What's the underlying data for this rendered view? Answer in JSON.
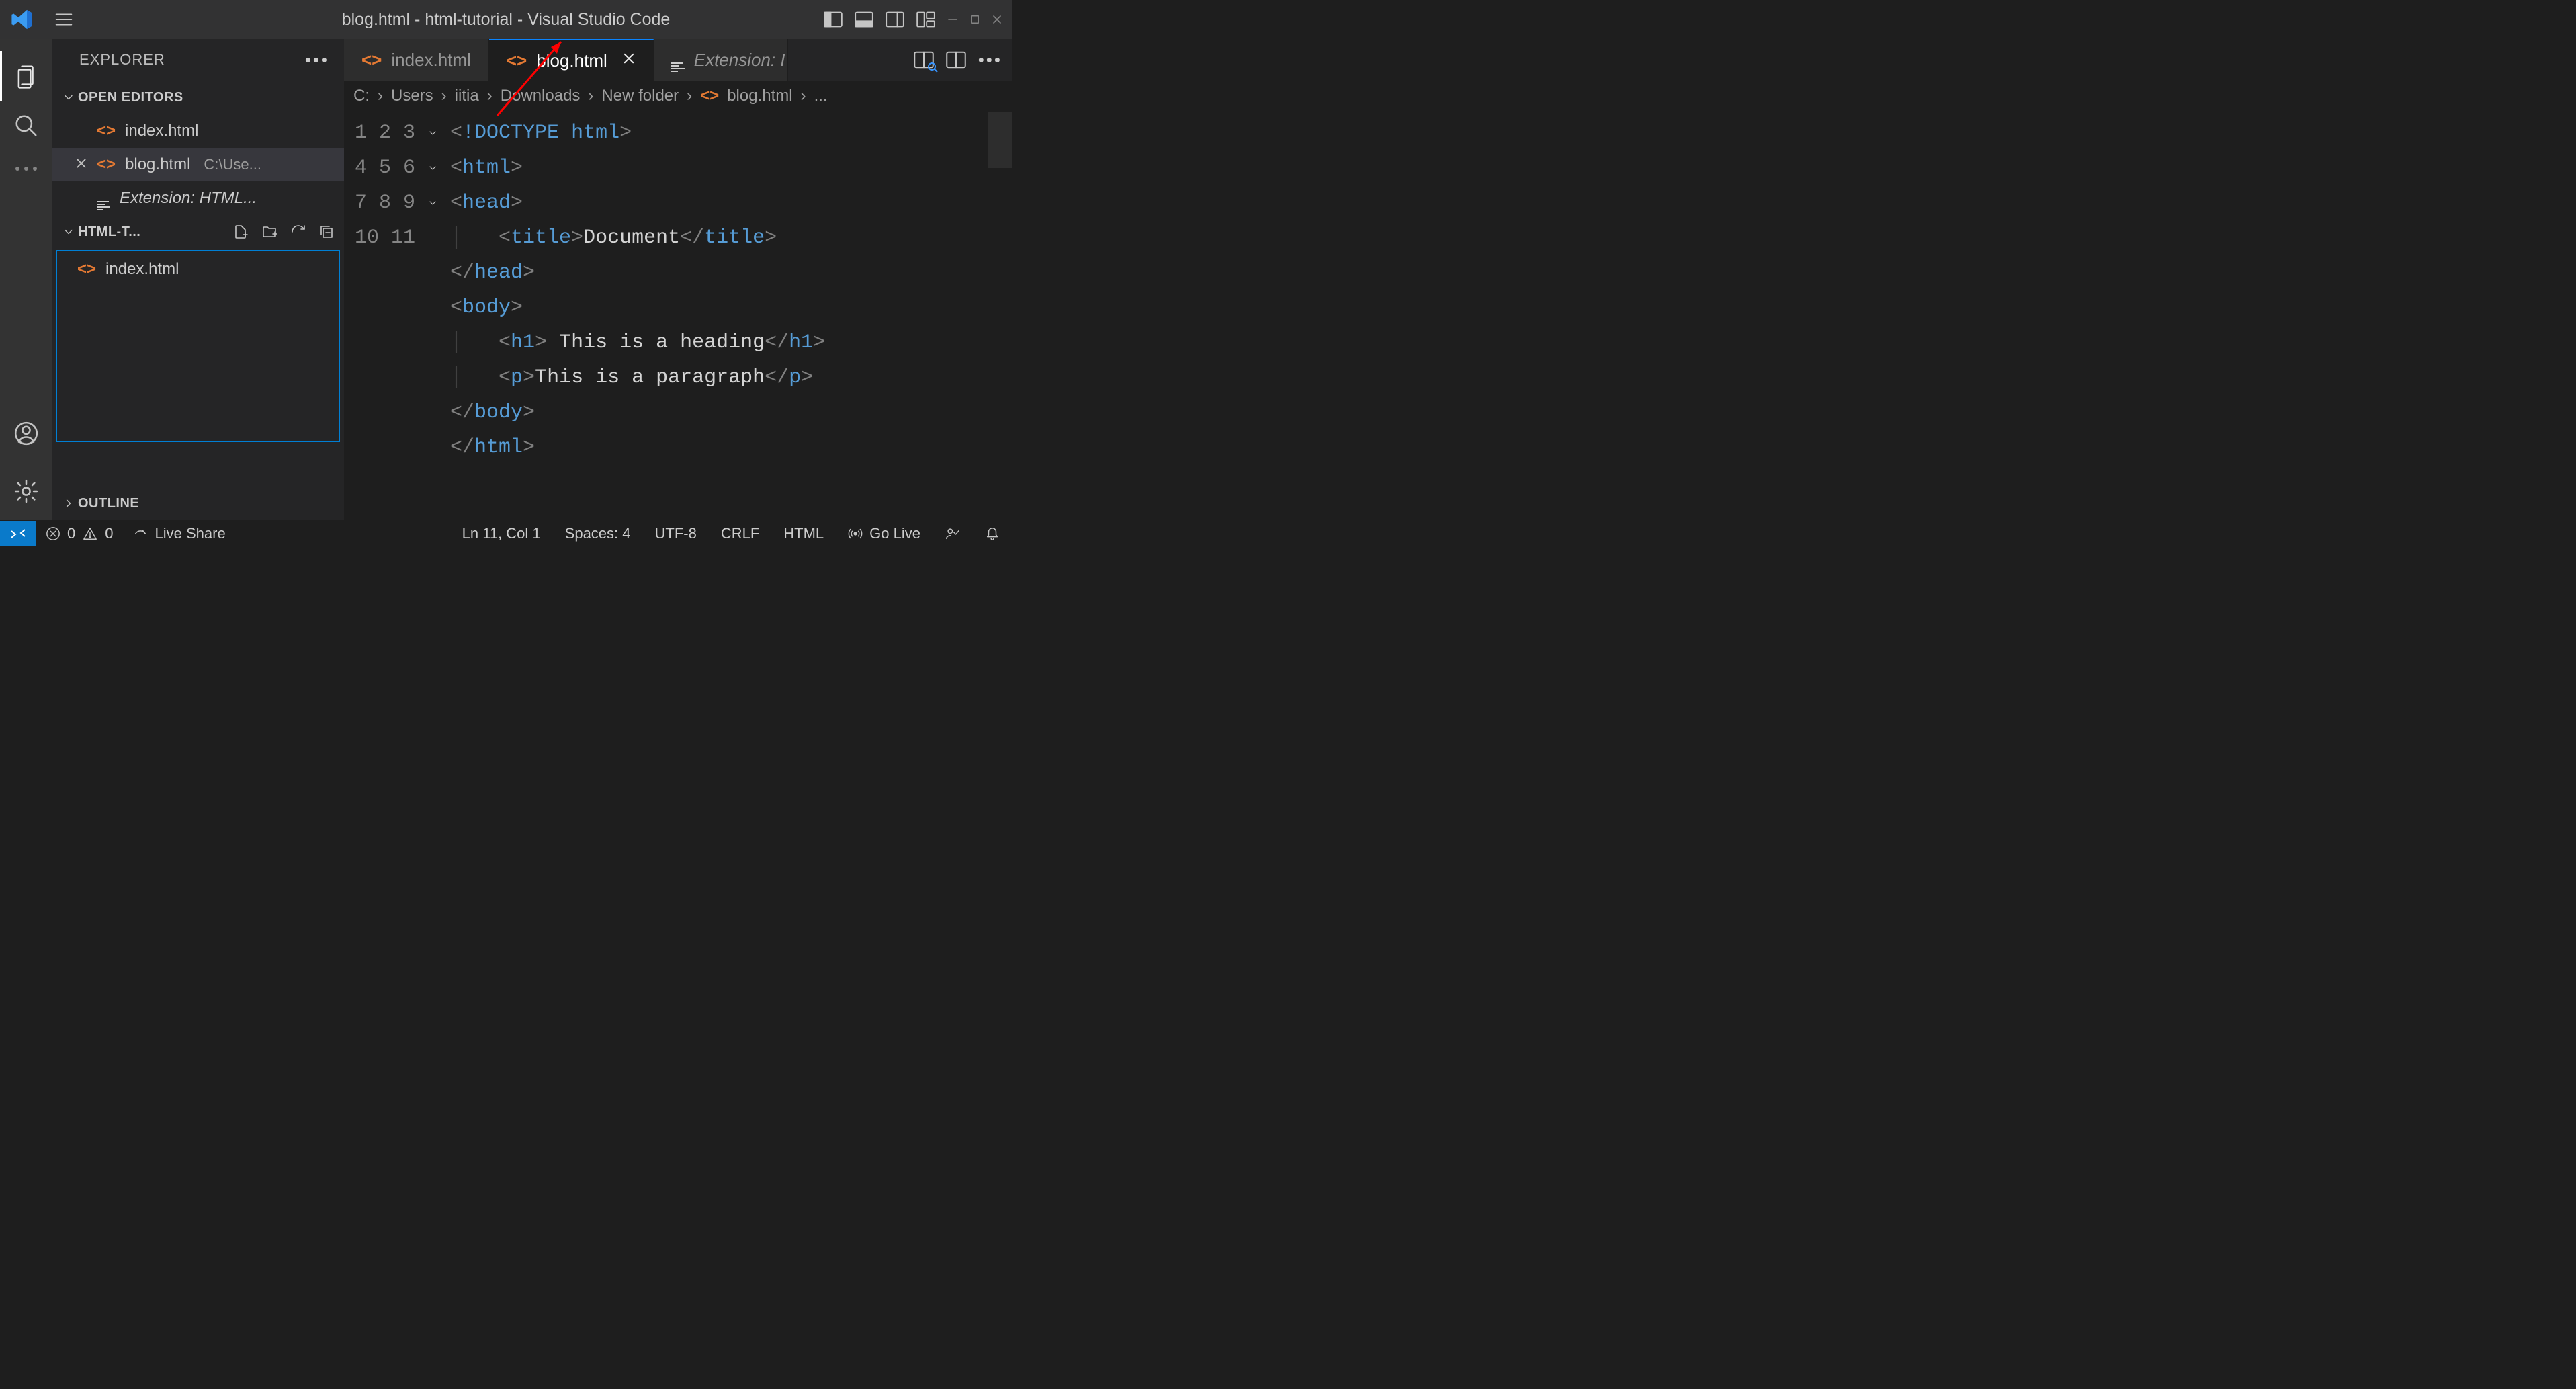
{
  "titlebar": {
    "title": "blog.html - html-tutorial - Visual Studio Code"
  },
  "activitybar": {
    "items": [
      "explorer",
      "search",
      "ellipsis"
    ],
    "bottom": [
      "accounts",
      "manage"
    ]
  },
  "sidebar": {
    "title": "EXPLORER",
    "open_editors": {
      "label": "OPEN EDITORS",
      "items": [
        {
          "name": "index.html",
          "kind": "html",
          "active": false,
          "meta": ""
        },
        {
          "name": "blog.html",
          "kind": "html",
          "active": true,
          "meta": "C:\\Use..."
        },
        {
          "name": "Extension: HTML...",
          "kind": "ext",
          "active": false,
          "meta": ""
        }
      ]
    },
    "folder": {
      "label": "HTML-T...",
      "files": [
        {
          "name": "index.html",
          "kind": "html"
        }
      ]
    },
    "outline_label": "OUTLINE"
  },
  "tabs": {
    "items": [
      {
        "name": "index.html",
        "kind": "html",
        "active": false,
        "closeable": false
      },
      {
        "name": "blog.html",
        "kind": "html",
        "active": true,
        "closeable": true
      },
      {
        "name": "Extension: I",
        "kind": "ext",
        "active": false,
        "closeable": false
      }
    ]
  },
  "breadcrumb": {
    "parts": [
      "C:",
      "Users",
      "iitia",
      "Downloads",
      "New folder"
    ],
    "file": "blog.html",
    "trailing": "..."
  },
  "code": {
    "lines": [
      {
        "n": 1,
        "fold": "",
        "html": "<span class='tok-br'>&lt;</span><span class='tok-bang'>!</span><span class='tok-doc'>DOCTYPE</span> <span class='tok-tag'>html</span><span class='tok-br'>&gt;</span>"
      },
      {
        "n": 2,
        "fold": "v",
        "html": "<span class='tok-br'>&lt;</span><span class='tok-tag'>html</span><span class='tok-br'>&gt;</span>"
      },
      {
        "n": 3,
        "fold": "v",
        "html": "<span class='tok-br'>&lt;</span><span class='tok-tag'>head</span><span class='tok-br'>&gt;</span>"
      },
      {
        "n": 4,
        "fold": "",
        "html": "<span class='indent-guide'>│   </span><span class='tok-br'>&lt;</span><span class='tok-tag'>title</span><span class='tok-br'>&gt;</span><span class='tok-txt'>Document</span><span class='tok-br'>&lt;/</span><span class='tok-tag'>title</span><span class='tok-br'>&gt;</span>"
      },
      {
        "n": 5,
        "fold": "",
        "html": "<span class='tok-br'>&lt;/</span><span class='tok-tag'>head</span><span class='tok-br'>&gt;</span>"
      },
      {
        "n": 6,
        "fold": "v",
        "html": "<span class='tok-br'>&lt;</span><span class='tok-tag'>body</span><span class='tok-br'>&gt;</span>"
      },
      {
        "n": 7,
        "fold": "",
        "html": "<span class='indent-guide'>│   </span><span class='tok-br'>&lt;</span><span class='tok-tag'>h1</span><span class='tok-br'>&gt;</span><span class='tok-txt'> This is a heading</span><span class='tok-br'>&lt;/</span><span class='tok-tag'>h1</span><span class='tok-br'>&gt;</span>"
      },
      {
        "n": 8,
        "fold": "",
        "html": "<span class='indent-guide'>│   </span><span class='tok-br'>&lt;</span><span class='tok-tag'>p</span><span class='tok-br'>&gt;</span><span class='tok-txt'>This is a paragraph</span><span class='tok-br'>&lt;/</span><span class='tok-tag'>p</span><span class='tok-br'>&gt;</span>"
      },
      {
        "n": 9,
        "fold": "",
        "html": "<span class='tok-br'>&lt;/</span><span class='tok-tag'>body</span><span class='tok-br'>&gt;</span>"
      },
      {
        "n": 10,
        "fold": "",
        "html": "<span class='tok-br'>&lt;/</span><span class='tok-tag'>html</span><span class='tok-br'>&gt;</span>"
      },
      {
        "n": 11,
        "fold": "",
        "html": ""
      }
    ]
  },
  "statusbar": {
    "errors": "0",
    "warnings": "0",
    "live_share": "Live Share",
    "cursor": "Ln 11, Col 1",
    "spaces": "Spaces: 4",
    "encoding": "UTF-8",
    "eol": "CRLF",
    "lang": "HTML",
    "go_live": "Go Live"
  }
}
